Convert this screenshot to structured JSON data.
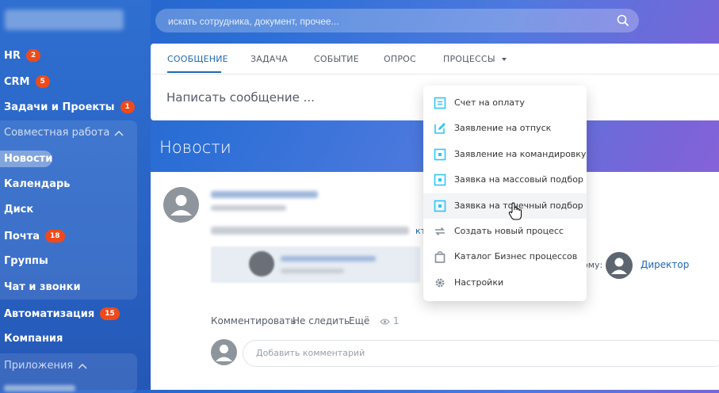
{
  "sidebar": {
    "items": [
      {
        "label": "HR",
        "badge": "2"
      },
      {
        "label": "CRM",
        "badge": "5"
      },
      {
        "label": "Задачи и Проекты",
        "badge": "1"
      },
      {
        "label": "Новости"
      },
      {
        "label": "Календарь"
      },
      {
        "label": "Диск"
      },
      {
        "label": "Почта",
        "badge": "18"
      },
      {
        "label": "Группы"
      },
      {
        "label": "Чат и звонки"
      },
      {
        "label": "Автоматизация",
        "badge": "15"
      },
      {
        "label": "Компания"
      }
    ],
    "group_collab": "Совместная работа",
    "group_apps": "Приложения"
  },
  "search": {
    "placeholder": "искать сотрудника, документ, прочее..."
  },
  "composer": {
    "tabs": [
      "СООБЩЕНИЕ",
      "ЗАДАЧА",
      "СОБЫТИЕ",
      "ОПРОС",
      "ПРОЦЕССЫ"
    ],
    "active_tab": "СООБЩЕНИЕ",
    "placeholder": "Написать сообщение ..."
  },
  "news": {
    "title": "Новости"
  },
  "post": {
    "recipient_suffix": "ому:",
    "recipient": "Директор",
    "link_fragment": "кт",
    "actions": [
      "Комментировать",
      "Не следить",
      "Ещё"
    ],
    "views": "1",
    "comment_placeholder": "Добавить комментарий"
  },
  "processes_menu": {
    "items": [
      {
        "label": "Счет на оплату",
        "icon": "invoice-icon"
      },
      {
        "label": "Заявление на отпуск",
        "icon": "edit-icon"
      },
      {
        "label": "Заявление на командировку",
        "icon": "form-icon"
      },
      {
        "label": "Заявка на массовый подбор",
        "icon": "form-icon"
      },
      {
        "label": "Заявка на точечный подбор",
        "icon": "form-icon"
      },
      {
        "label": "Создать новый процесс",
        "icon": "refresh-icon"
      },
      {
        "label": "Каталог Бизнес процессов",
        "icon": "bag-icon"
      },
      {
        "label": "Настройки",
        "icon": "gear-icon"
      }
    ]
  },
  "colors": {
    "accent": "#2067b0",
    "badge": "#f04a1a",
    "menu_icon": "#2fc6f6"
  }
}
